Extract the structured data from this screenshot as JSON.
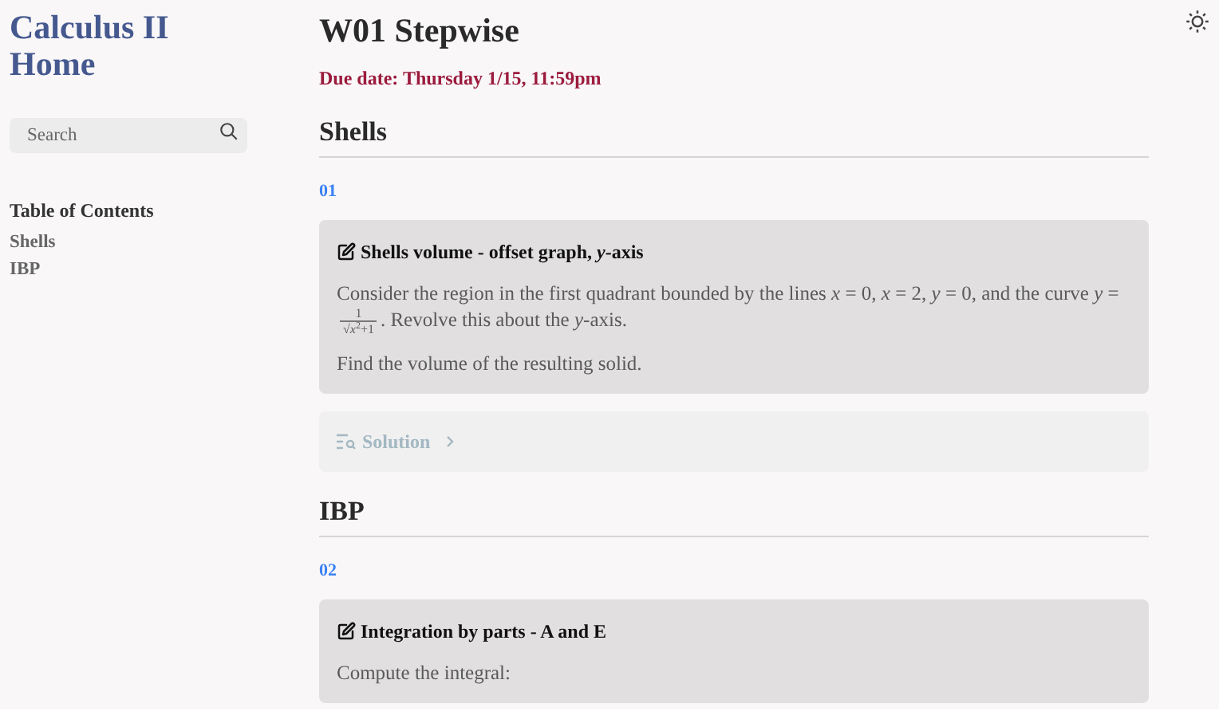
{
  "sidebar": {
    "title": "Calculus II Home",
    "search": {
      "placeholder": "Search"
    },
    "toc_heading": "Table of Contents",
    "toc_items": [
      {
        "label": "Shells"
      },
      {
        "label": "IBP"
      }
    ]
  },
  "page": {
    "title": "W01 Stepwise",
    "due_date": "Due date: Thursday 1/15, 11:59pm"
  },
  "sections": [
    {
      "heading": "Shells",
      "problems": [
        {
          "number": "01",
          "title": "Shells volume - offset graph, *y*-axis",
          "paragraphs": [
            [
              {
                "kind": "text",
                "text": "Consider the region in the first quadrant bounded by the lines *x* = 0, *x* = 2, *y* = 0, and the curve *y* = "
              },
              {
                "kind": "fraction",
                "numerator": "1",
                "denominator": "√*x*$^{2}$+1"
              },
              {
                "kind": "text",
                "text": ". Revolve this about the *y*-axis."
              }
            ],
            [
              {
                "kind": "text",
                "text": "Find the volume of the resulting solid."
              }
            ]
          ],
          "solution": {
            "label": "Solution",
            "expanded": false
          }
        }
      ]
    },
    {
      "heading": "IBP",
      "problems": [
        {
          "number": "02",
          "title": "Integration by parts - A and E",
          "paragraphs": [
            [
              {
                "kind": "text",
                "text": "Compute the integral:"
              }
            ]
          ]
        }
      ]
    }
  ]
}
